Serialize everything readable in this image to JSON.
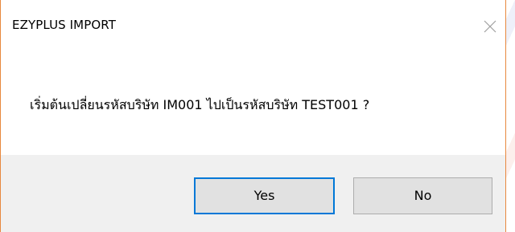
{
  "dialog": {
    "title": "EZYPLUS IMPORT",
    "message": "เริ่มต้นเปลี่ยนรหัสบริษัท IM001 ไปเป็นรหัสบริษัท TEST001 ?",
    "buttons": {
      "yes_label": "Yes",
      "no_label": "No"
    },
    "close_icon": "close-icon"
  },
  "colors": {
    "window_border": "#e8883e",
    "footer_background": "#f0f0f0",
    "default_button_border": "#0078d7",
    "button_background": "#e1e1e1"
  }
}
